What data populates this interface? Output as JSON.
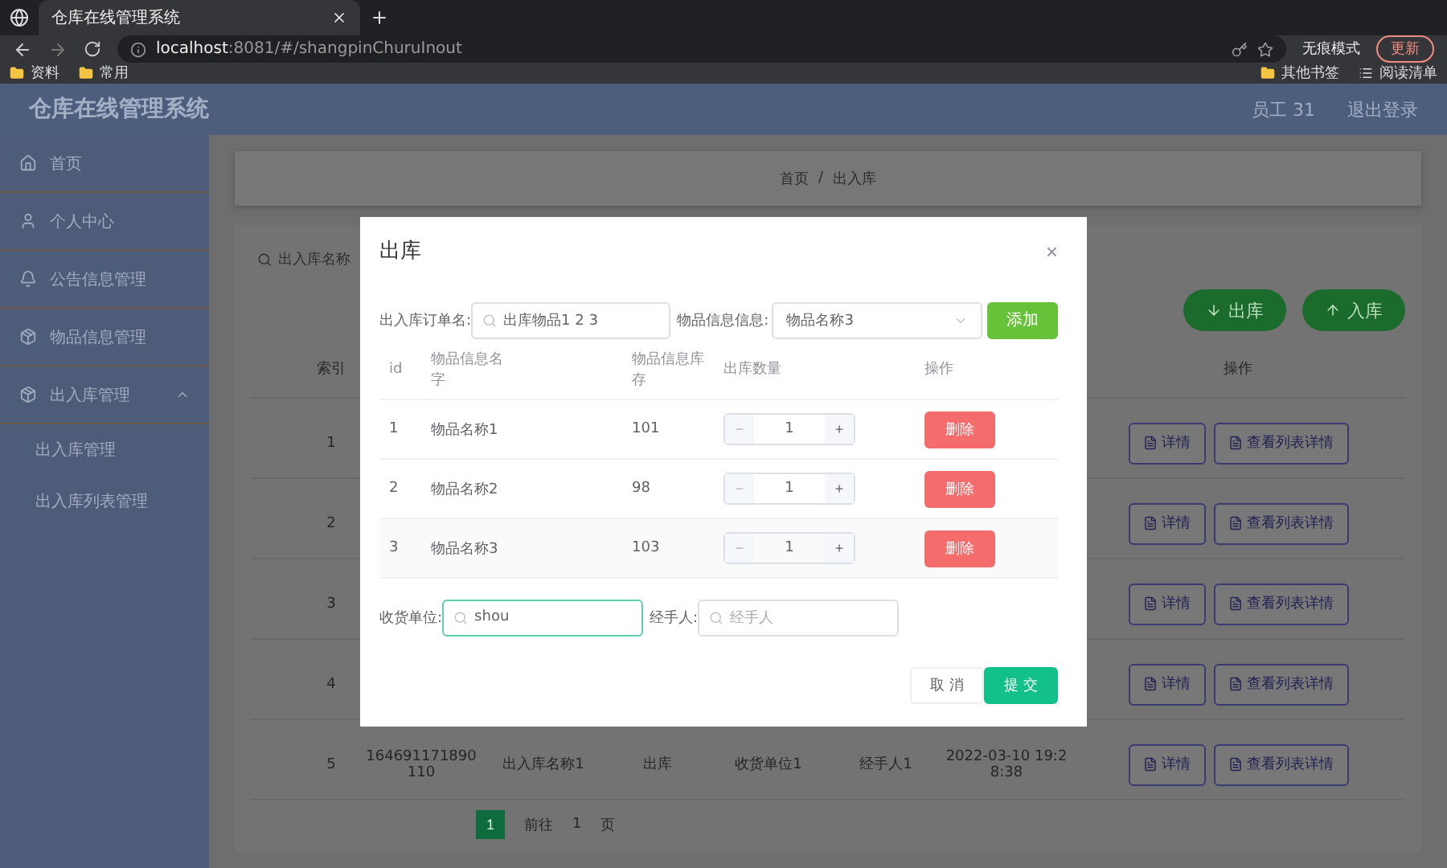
{
  "browser": {
    "tabs": [
      {
        "title": "仓库在线管理系统",
        "selected": true
      }
    ],
    "url_host": "localhost",
    "url_rest": ":8081/#/shangpinChuruInout",
    "incognito_label": "无痕模式",
    "update_button": "更新",
    "bookmarks": [
      "资料",
      "常用"
    ],
    "bookmarks_right": [
      "其他书签",
      "阅读清单"
    ]
  },
  "header": {
    "title": "仓库在线管理系统",
    "user": "员工 31",
    "logout": "退出登录"
  },
  "sidebar": {
    "items": [
      {
        "label": "首页"
      },
      {
        "label": "个人中心"
      },
      {
        "label": "公告信息管理"
      },
      {
        "label": "物品信息管理"
      },
      {
        "label": "出入库管理",
        "expanded": true,
        "children": [
          {
            "label": "出入库管理"
          },
          {
            "label": "出入库列表管理"
          }
        ]
      }
    ]
  },
  "breadcrumb": {
    "items": [
      "首页",
      "出入库"
    ],
    "separator": "/"
  },
  "search": {
    "placeholder": "出入库名称"
  },
  "actions": [
    {
      "label": "出库",
      "kind": "down"
    },
    {
      "label": "入库",
      "kind": "up"
    }
  ],
  "table": {
    "index_header": "索引",
    "actions_header": "操作",
    "rows": [
      {
        "index": "1",
        "buttons": [
          "详情",
          "查看列表详情"
        ]
      },
      {
        "index": "2",
        "buttons": [
          "详情",
          "查看列表详情"
        ]
      },
      {
        "index": "3",
        "buttons": [
          "详情",
          "查看列表详情"
        ]
      },
      {
        "index": "4",
        "buttons": [
          "详情",
          "查看列表详情"
        ]
      },
      {
        "index": "5",
        "cells": [
          "164691171890 110",
          "出入库名称1",
          "出库",
          "收货单位1",
          "经手人1",
          "2022-03-10 19:28:38"
        ],
        "buttons": [
          "详情",
          "查看列表详情"
        ]
      }
    ]
  },
  "pagination": {
    "pages": [
      {
        "label": "1",
        "selected": true
      }
    ],
    "goto_label": "前往",
    "goto_value": "1",
    "page_unit": "页"
  },
  "dialog": {
    "title": "出库",
    "close": "×",
    "order_label": "出入库订单名:",
    "order_value": "出库物品1 2 3",
    "item_label": "物品信息信息:",
    "item_value": "物品名称3",
    "add_button": "添加",
    "columns": [
      "id",
      "物品信息名字",
      "物品信息库存",
      "出库数量",
      "操作"
    ],
    "rows": [
      {
        "id": "1",
        "name": "物品名称1",
        "stock": "101",
        "qty": "1",
        "minus_disabled": true,
        "delete": "删除"
      },
      {
        "id": "2",
        "name": "物品名称2",
        "stock": "98",
        "qty": "1",
        "minus_disabled": true,
        "delete": "删除"
      },
      {
        "id": "3",
        "name": "物品名称3",
        "stock": "103",
        "qty": "1",
        "minus_disabled": true,
        "delete": "删除"
      }
    ],
    "minus": "−",
    "plus": "+",
    "receiver_label": "收货单位:",
    "receiver_value": "shou",
    "receiver_focused": true,
    "handler_label": "经手人:",
    "handler_placeholder": "经手人",
    "cancel": "取 消",
    "submit": "提 交"
  }
}
